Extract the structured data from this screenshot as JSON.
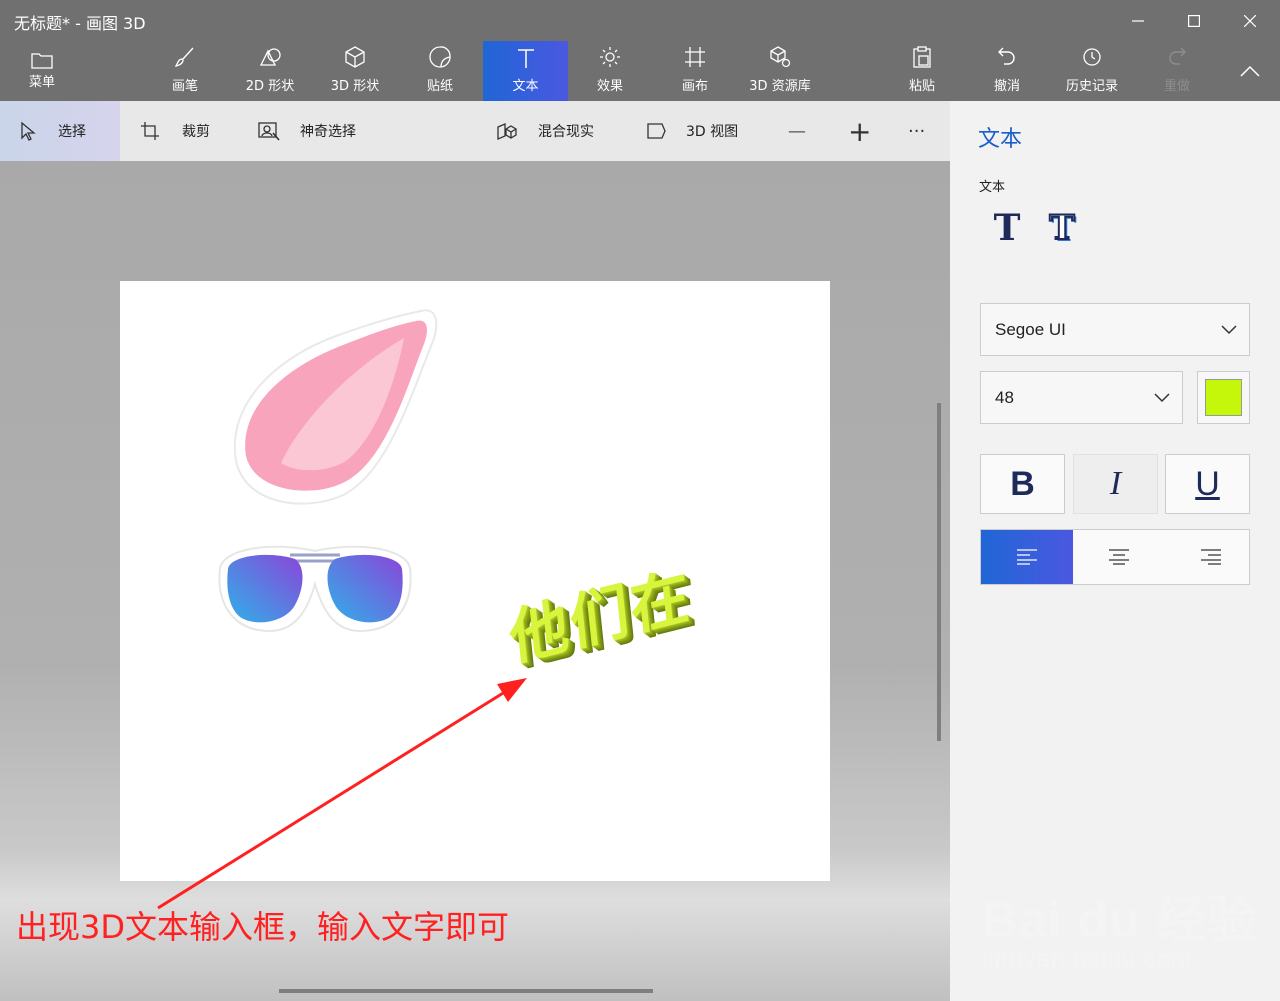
{
  "window": {
    "title": "无标题* - 画图 3D",
    "minimize_glyph": "—",
    "close_glyph": "✕"
  },
  "ribbon": {
    "menu": "菜单",
    "brushes": "画笔",
    "shapes2d": "2D 形状",
    "shapes3d": "3D 形状",
    "stickers": "贴纸",
    "text": "文本",
    "effects": "效果",
    "canvas": "画布",
    "library3d": "3D 资源库",
    "paste": "粘贴",
    "undo": "撤消",
    "history": "历史记录",
    "redo": "重做",
    "active_tab": "文本"
  },
  "toolbar": {
    "select": "选择",
    "crop": "裁剪",
    "magic_select": "神奇选择",
    "mixed_reality": "混合现实",
    "view3d": "3D 视图",
    "zoom_out": "—",
    "zoom_in": "+",
    "more": "···"
  },
  "canvas": {
    "text3d": "他们在",
    "annotation": "出现3D文本输入框，输入文字即可",
    "annotation_color": "#ff2020"
  },
  "panel": {
    "title": "文本",
    "section_label": "文本",
    "text_type_2d_icon": "T",
    "text_type_3d_icon": "T",
    "font": "Segoe UI",
    "size": "48",
    "color": "#c5f70a",
    "bold": "B",
    "italic": "I",
    "underline": "U",
    "alignment": "left"
  },
  "watermark": {
    "brand": "Bai du 经验",
    "url": "jingyan.baidu.com"
  }
}
